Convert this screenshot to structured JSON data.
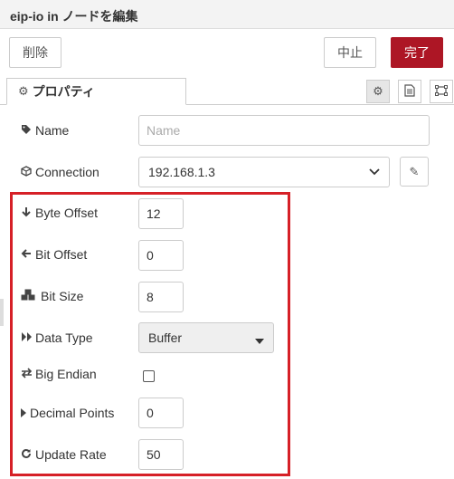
{
  "header": {
    "title": "eip-io in ノードを編集"
  },
  "toolbar": {
    "delete_label": "削除",
    "cancel_label": "中止",
    "done_label": "完了"
  },
  "tabs": {
    "properties_label": "プロパティ"
  },
  "tool_icons": [
    "gear-icon",
    "description-icon",
    "appearance-icon"
  ],
  "form": {
    "name": {
      "label": "Name",
      "value": "",
      "placeholder": "Name"
    },
    "connection": {
      "label": "Connection",
      "value": "192.168.1.3"
    },
    "byte_offset": {
      "label": "Byte Offset",
      "value": "12"
    },
    "bit_offset": {
      "label": "Bit Offset",
      "value": "0"
    },
    "bit_size": {
      "label": "Bit Size",
      "value": "8"
    },
    "data_type": {
      "label": "Data Type",
      "value": "Buffer"
    },
    "big_endian": {
      "label": "Big Endian",
      "checked": false
    },
    "decimal_points": {
      "label": "Decimal Points",
      "value": "0"
    },
    "update_rate": {
      "label": "Update Rate",
      "value": "50"
    }
  },
  "colors": {
    "primary": "#ad1625",
    "highlight": "#d62027"
  }
}
